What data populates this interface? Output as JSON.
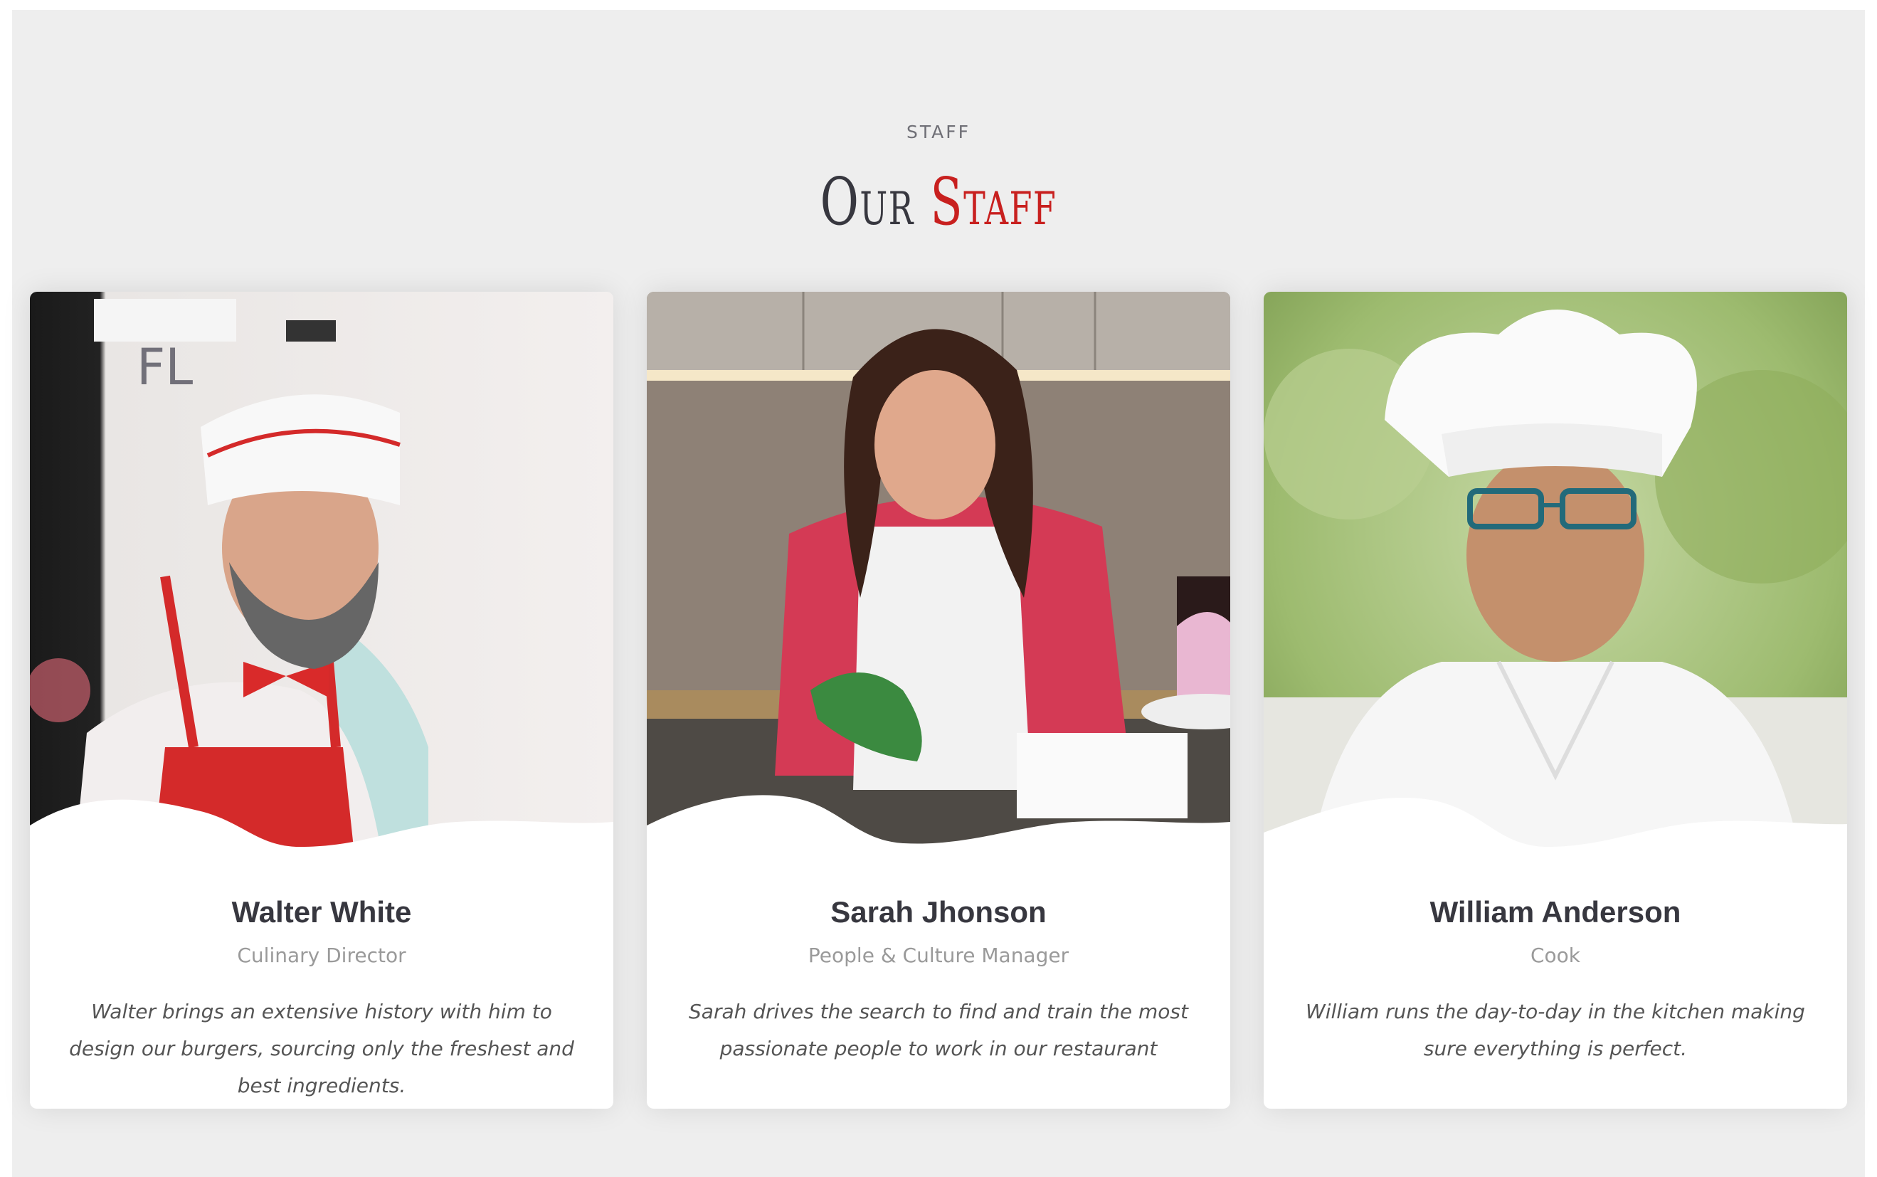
{
  "section": {
    "eyebrow": "STAFF",
    "title_part1": "Our",
    "title_part2": "Staff"
  },
  "colors": {
    "accent": "#c8201f",
    "heading": "#37373f",
    "background": "#eeeeee"
  },
  "staff": [
    {
      "name": "Walter White",
      "role": "Culinary Director",
      "bio": "Walter brings an extensive history with him to design our burgers, sourcing only the freshest and best ingredients."
    },
    {
      "name": "Sarah Jhonson",
      "role": "People & Culture Manager",
      "bio": "Sarah drives the search to find and train the most passionate people to work in our restaurant"
    },
    {
      "name": "William Anderson",
      "role": "Cook",
      "bio": "William runs the day-to-day in the kitchen making sure everything is perfect."
    }
  ]
}
